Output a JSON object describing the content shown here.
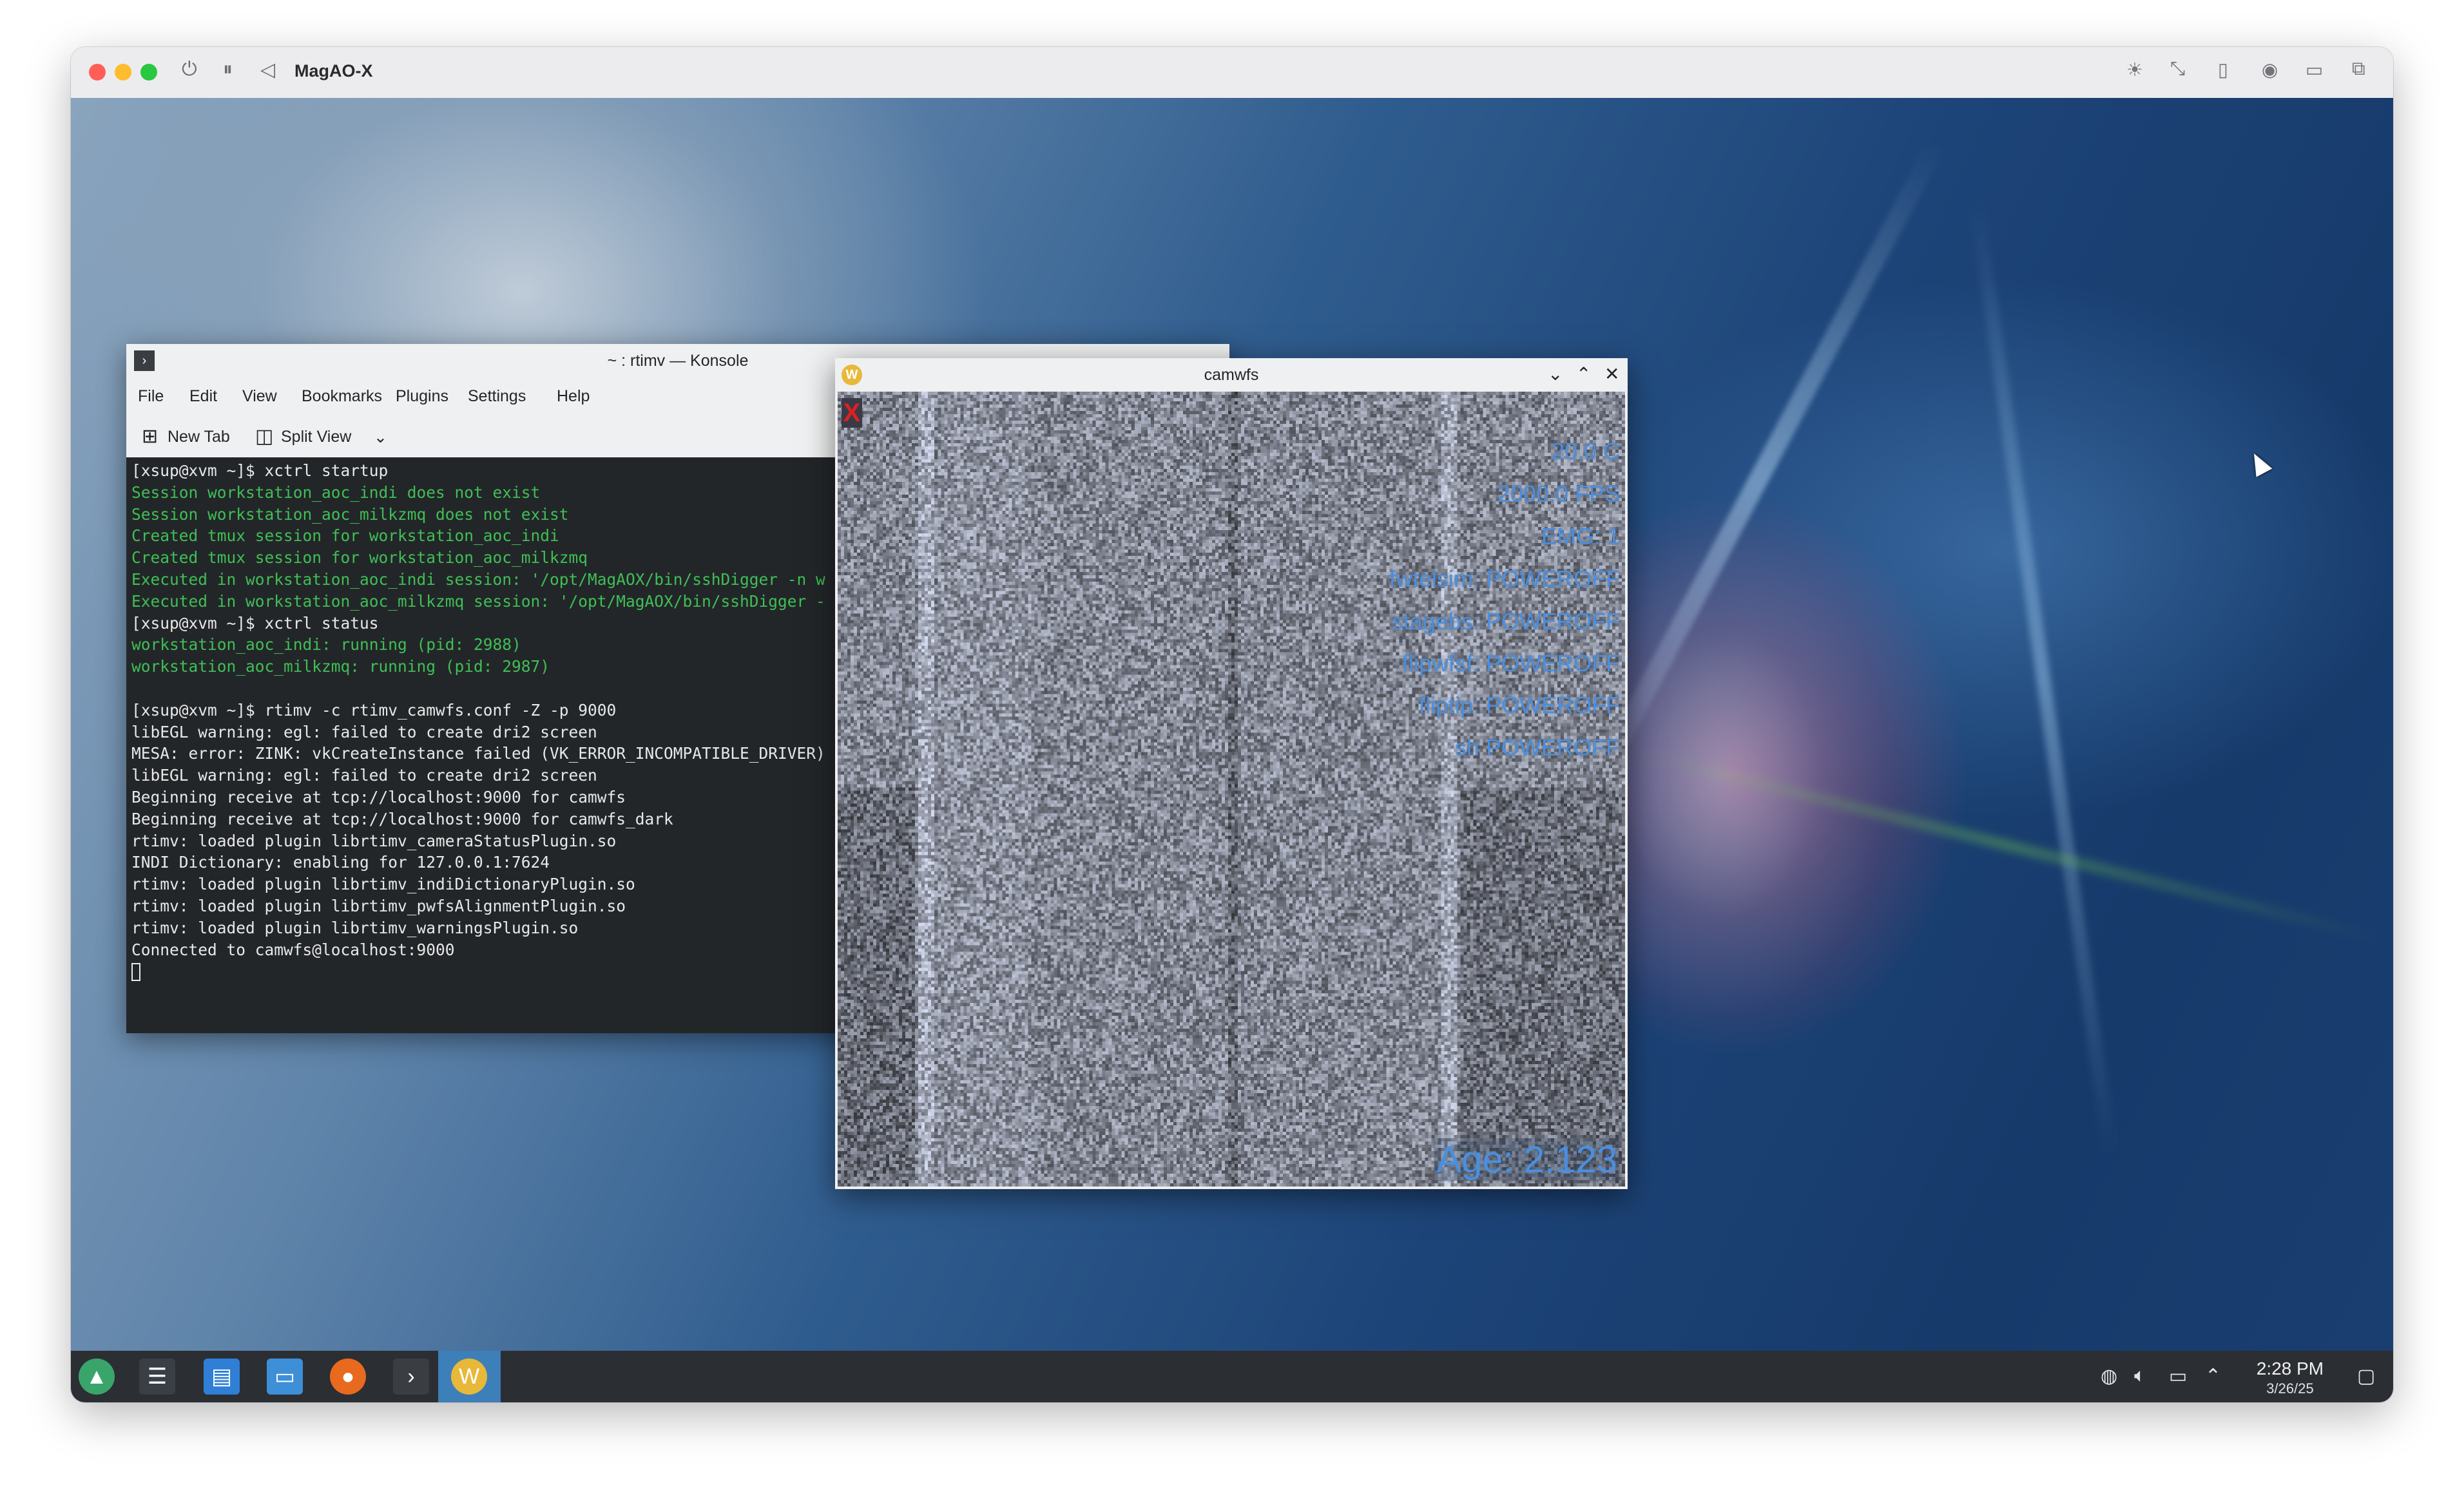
{
  "vm": {
    "title": "MagAO-X",
    "colors": {
      "close": "#ff5f57",
      "minimize": "#febc2e",
      "zoom": "#28c840"
    },
    "controls": [
      "power-icon",
      "pause-icon",
      "back-icon"
    ],
    "toolbar_icons": [
      "brightness-icon",
      "resize-icon",
      "usb-icon",
      "camera-icon",
      "folder-icon",
      "windows-icon"
    ]
  },
  "konsole": {
    "title": "~ : rtimv — Konsole",
    "menu": [
      "File",
      "Edit",
      "View",
      "Bookmarks",
      "Plugins",
      "Settings",
      "Help"
    ],
    "toolbar": {
      "new_tab": "New Tab",
      "split_view": "Split View"
    },
    "lines": [
      {
        "text": "[xsup@xvm ~]$ xctrl startup",
        "color": "white"
      },
      {
        "text": "Session workstation_aoc_indi does not exist",
        "color": "green"
      },
      {
        "text": "Session workstation_aoc_milkzmq does not exist",
        "color": "green"
      },
      {
        "text": "Created tmux session for workstation_aoc_indi",
        "color": "green"
      },
      {
        "text": "Created tmux session for workstation_aoc_milkzmq",
        "color": "green"
      },
      {
        "text": "Executed in workstation_aoc_indi session: '/opt/MagAOX/bin/sshDigger -n w",
        "color": "green"
      },
      {
        "text": "Executed in workstation_aoc_milkzmq session: '/opt/MagAOX/bin/sshDigger -",
        "color": "green"
      },
      {
        "text": "[xsup@xvm ~]$ xctrl status",
        "color": "white"
      },
      {
        "text": "workstation_aoc_indi: running (pid: 2988)",
        "color": "green"
      },
      {
        "text": "workstation_aoc_milkzmq: running (pid: 2987)",
        "color": "green"
      },
      {
        "text": "",
        "color": "white"
      },
      {
        "text": "[xsup@xvm ~]$ rtimv -c rtimv_camwfs.conf -Z -p 9000",
        "color": "white"
      },
      {
        "text": "libEGL warning: egl: failed to create dri2 screen",
        "color": "white"
      },
      {
        "text": "MESA: error: ZINK: vkCreateInstance failed (VK_ERROR_INCOMPATIBLE_DRIVER)",
        "color": "white"
      },
      {
        "text": "libEGL warning: egl: failed to create dri2 screen",
        "color": "white"
      },
      {
        "text": "Beginning receive at tcp://localhost:9000 for camwfs",
        "color": "white"
      },
      {
        "text": "Beginning receive at tcp://localhost:9000 for camwfs_dark",
        "color": "white"
      },
      {
        "text": "rtimv: loaded plugin librtimv_cameraStatusPlugin.so",
        "color": "white"
      },
      {
        "text": "INDI Dictionary: enabling for 127.0.0.1:7624",
        "color": "white"
      },
      {
        "text": "rtimv: loaded plugin librtimv_indiDictionaryPlugin.so",
        "color": "white"
      },
      {
        "text": "rtimv: loaded plugin librtimv_pwfsAlignmentPlugin.so",
        "color": "white"
      },
      {
        "text": "rtimv: loaded plugin librtimv_warningsPlugin.so",
        "color": "white"
      },
      {
        "text": "Connected to camwfs@localhost:9000",
        "color": "white"
      }
    ],
    "colors": {
      "background": "#232629",
      "white": "#e8e8e8",
      "green": "#3fbf55"
    }
  },
  "camwfs": {
    "title": "camwfs",
    "x_mark": "X",
    "stats": [
      "20.0 C",
      "2000.0 FPS",
      "EMG: 1",
      "fwtelsim: POWEROFF",
      "stagebs: POWEROFF",
      "flipwfsf: POWEROFF",
      "fliptip: POWEROFF",
      "sh POWEROFF"
    ],
    "age": "Age: 2.123",
    "text_color": "#4a8fe0"
  },
  "taskbar": {
    "icons": [
      "app-launcher-icon",
      "settings-icon",
      "discover-store-icon",
      "file-manager-icon",
      "firefox-icon",
      "konsole-icon",
      "rtimv-icon"
    ],
    "tray": [
      "network-icon",
      "volume-icon",
      "display-icon",
      "chevron-up-icon"
    ],
    "time": "2:28 PM",
    "date": "3/26/25",
    "accent": "#3d7fb8"
  }
}
